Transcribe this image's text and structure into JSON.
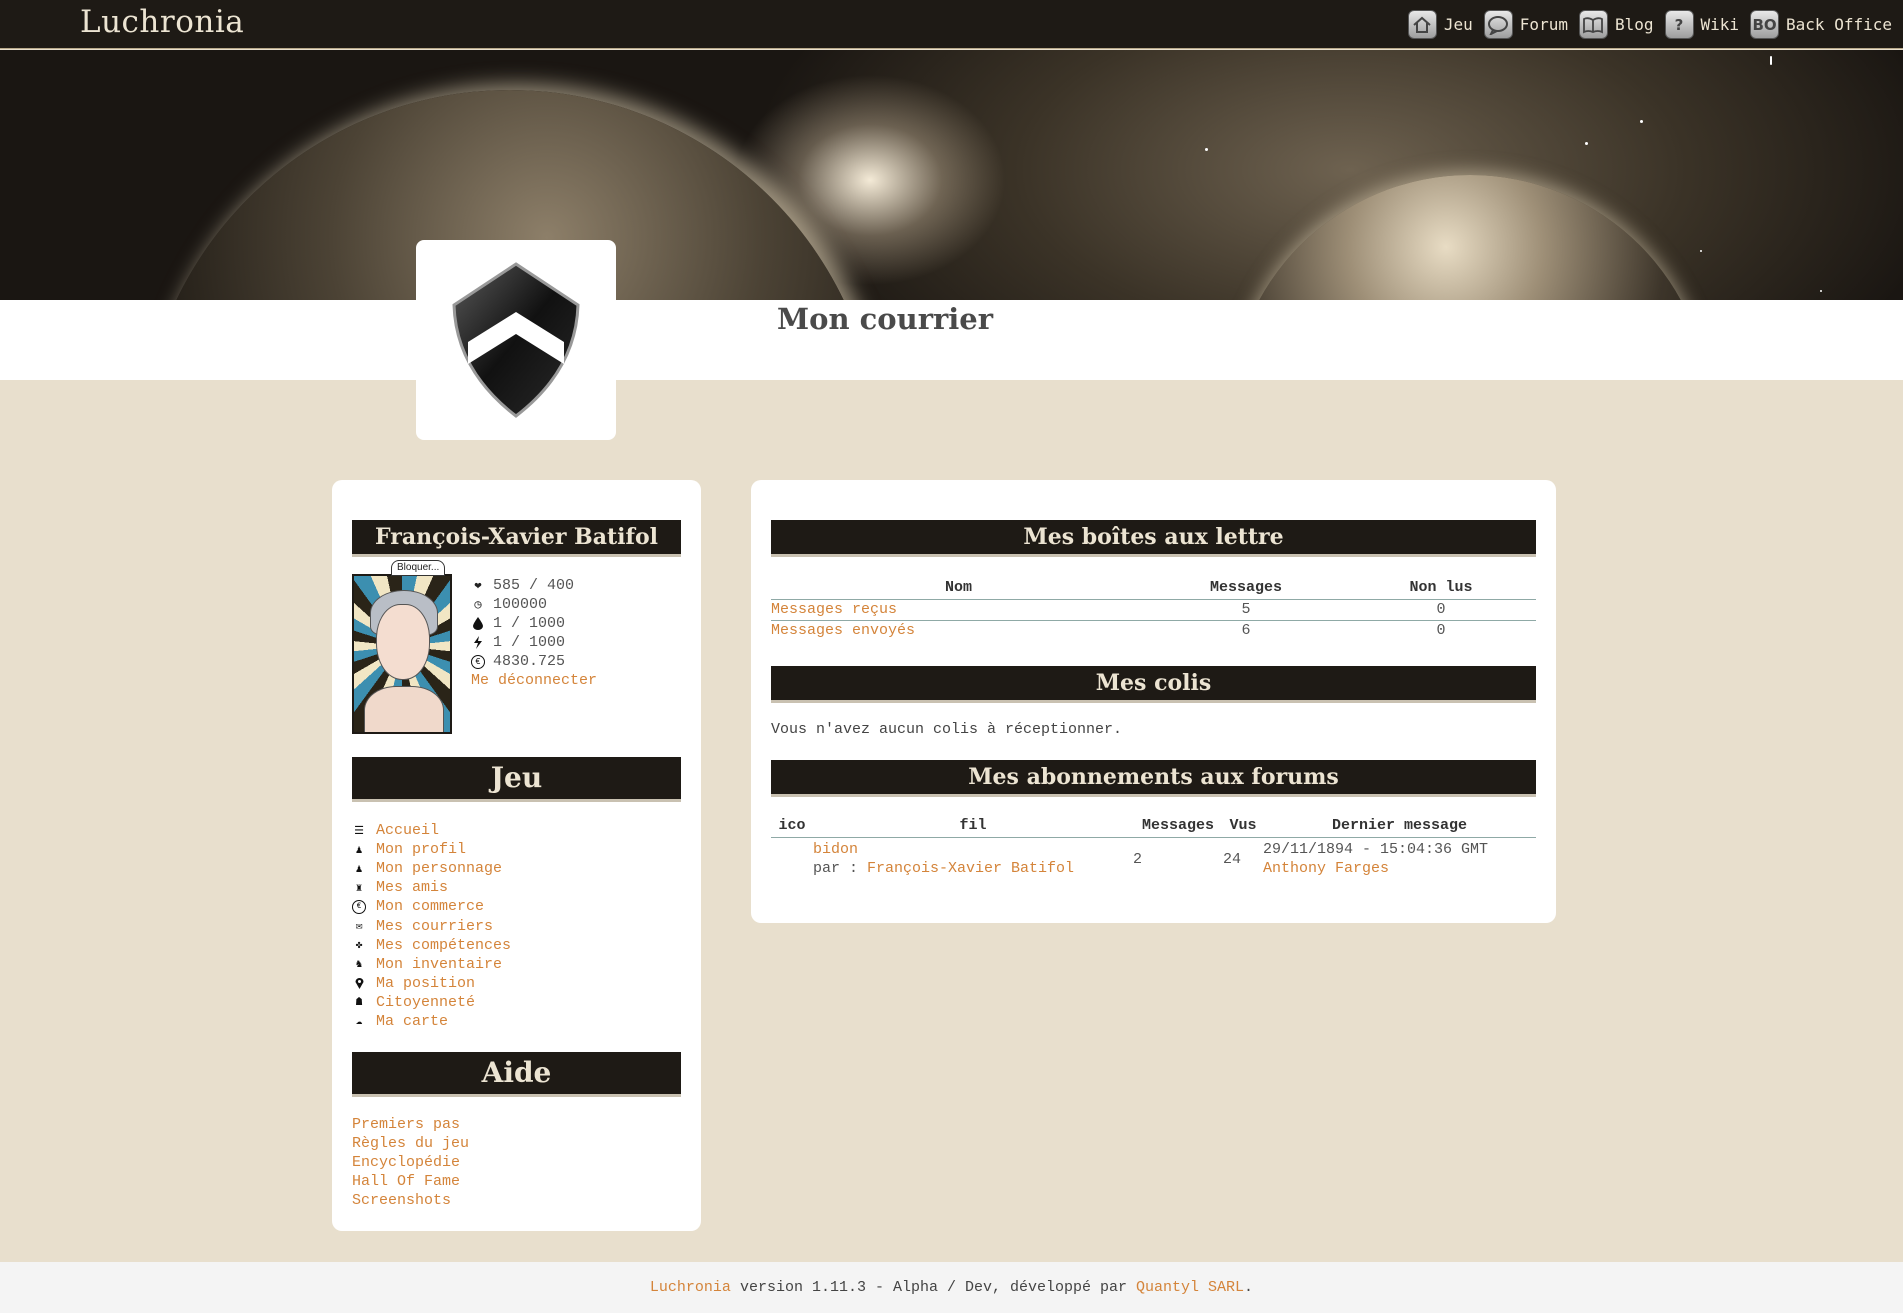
{
  "topbar": {
    "brand": "Luchronia",
    "nav": [
      {
        "label": "Jeu",
        "icon": "home-icon"
      },
      {
        "label": "Forum",
        "icon": "speech-bubble-icon"
      },
      {
        "label": "Blog",
        "icon": "book-icon"
      },
      {
        "label": "Wiki",
        "icon": "question-icon"
      },
      {
        "label": "Back Office",
        "icon": "bo-icon",
        "icon_text": "BO"
      }
    ]
  },
  "page": {
    "title": "Mon courrier"
  },
  "player": {
    "name": "François-Xavier Batifol",
    "block_label": "Bloquer...",
    "stats": [
      {
        "icon": "heart-icon",
        "value": "585 / 400"
      },
      {
        "icon": "clock-icon",
        "value": "100000"
      },
      {
        "icon": "drop-icon",
        "value": "1 / 1000"
      },
      {
        "icon": "lightning-icon",
        "value": "1 / 1000"
      },
      {
        "icon": "euro-icon",
        "value": "4830.725"
      }
    ],
    "logout": "Me déconnecter"
  },
  "jeu": {
    "title": "Jeu",
    "items": [
      {
        "label": "Accueil",
        "icon": "list-icon"
      },
      {
        "label": "Mon profil",
        "icon": "person-icon"
      },
      {
        "label": "Mon personnage",
        "icon": "person-icon"
      },
      {
        "label": "Mes amis",
        "icon": "friends-icon"
      },
      {
        "label": "Mon commerce",
        "icon": "euro-icon"
      },
      {
        "label": "Mes courriers",
        "icon": "envelope-icon"
      },
      {
        "label": "Mes compétences",
        "icon": "skills-icon"
      },
      {
        "label": "Mon inventaire",
        "icon": "bag-icon"
      },
      {
        "label": "Ma position",
        "icon": "pin-icon"
      },
      {
        "label": "Citoyenneté",
        "icon": "citizen-icon"
      },
      {
        "label": "Ma carte",
        "icon": "map-icon"
      }
    ]
  },
  "aide": {
    "title": "Aide",
    "links": [
      "Premiers pas",
      "Règles du jeu",
      "Encyclopédie",
      "Hall Of Fame",
      "Screenshots"
    ]
  },
  "boites": {
    "title": "Mes boîtes aux lettre",
    "columns": [
      "Nom",
      "Messages",
      "Non lus"
    ],
    "rows": [
      {
        "name": "Messages reçus",
        "messages": "5",
        "unread": "0"
      },
      {
        "name": "Messages envoyés",
        "messages": "6",
        "unread": "0"
      }
    ]
  },
  "colis": {
    "title": "Mes colis",
    "empty": "Vous n'avez aucun colis à réceptionner."
  },
  "forums": {
    "title": "Mes abonnements aux forums",
    "columns": [
      "ico",
      "fil",
      "Messages",
      "Vus",
      "Dernier message"
    ],
    "rows": [
      {
        "thread": "bidon",
        "by_label": "par : ",
        "author": "François-Xavier Batifol",
        "messages": "2",
        "views": "24",
        "last_date": "29/11/1894 - 15:04:36 GMT",
        "last_author": "Anthony Farges"
      }
    ]
  },
  "footer": {
    "app": "Luchronia",
    "version_text": " version 1.11.3 - Alpha / Dev, développé par ",
    "company": "Quantyl SARL",
    "end": "."
  }
}
